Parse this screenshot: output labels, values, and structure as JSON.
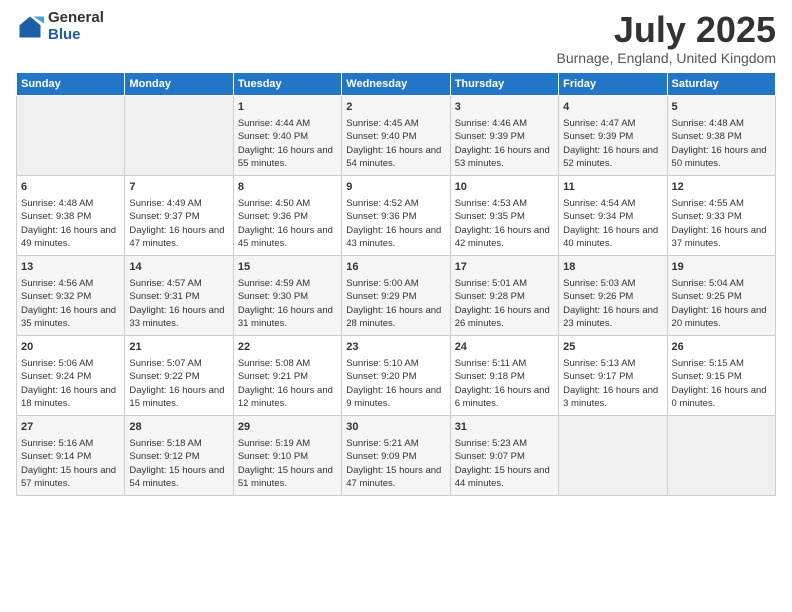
{
  "logo": {
    "general": "General",
    "blue": "Blue"
  },
  "title": "July 2025",
  "subtitle": "Burnage, England, United Kingdom",
  "days_of_week": [
    "Sunday",
    "Monday",
    "Tuesday",
    "Wednesday",
    "Thursday",
    "Friday",
    "Saturday"
  ],
  "weeks": [
    [
      {
        "day": "",
        "sunrise": "",
        "sunset": "",
        "daylight": ""
      },
      {
        "day": "",
        "sunrise": "",
        "sunset": "",
        "daylight": ""
      },
      {
        "day": "1",
        "sunrise": "Sunrise: 4:44 AM",
        "sunset": "Sunset: 9:40 PM",
        "daylight": "Daylight: 16 hours and 55 minutes."
      },
      {
        "day": "2",
        "sunrise": "Sunrise: 4:45 AM",
        "sunset": "Sunset: 9:40 PM",
        "daylight": "Daylight: 16 hours and 54 minutes."
      },
      {
        "day": "3",
        "sunrise": "Sunrise: 4:46 AM",
        "sunset": "Sunset: 9:39 PM",
        "daylight": "Daylight: 16 hours and 53 minutes."
      },
      {
        "day": "4",
        "sunrise": "Sunrise: 4:47 AM",
        "sunset": "Sunset: 9:39 PM",
        "daylight": "Daylight: 16 hours and 52 minutes."
      },
      {
        "day": "5",
        "sunrise": "Sunrise: 4:48 AM",
        "sunset": "Sunset: 9:38 PM",
        "daylight": "Daylight: 16 hours and 50 minutes."
      }
    ],
    [
      {
        "day": "6",
        "sunrise": "Sunrise: 4:48 AM",
        "sunset": "Sunset: 9:38 PM",
        "daylight": "Daylight: 16 hours and 49 minutes."
      },
      {
        "day": "7",
        "sunrise": "Sunrise: 4:49 AM",
        "sunset": "Sunset: 9:37 PM",
        "daylight": "Daylight: 16 hours and 47 minutes."
      },
      {
        "day": "8",
        "sunrise": "Sunrise: 4:50 AM",
        "sunset": "Sunset: 9:36 PM",
        "daylight": "Daylight: 16 hours and 45 minutes."
      },
      {
        "day": "9",
        "sunrise": "Sunrise: 4:52 AM",
        "sunset": "Sunset: 9:36 PM",
        "daylight": "Daylight: 16 hours and 43 minutes."
      },
      {
        "day": "10",
        "sunrise": "Sunrise: 4:53 AM",
        "sunset": "Sunset: 9:35 PM",
        "daylight": "Daylight: 16 hours and 42 minutes."
      },
      {
        "day": "11",
        "sunrise": "Sunrise: 4:54 AM",
        "sunset": "Sunset: 9:34 PM",
        "daylight": "Daylight: 16 hours and 40 minutes."
      },
      {
        "day": "12",
        "sunrise": "Sunrise: 4:55 AM",
        "sunset": "Sunset: 9:33 PM",
        "daylight": "Daylight: 16 hours and 37 minutes."
      }
    ],
    [
      {
        "day": "13",
        "sunrise": "Sunrise: 4:56 AM",
        "sunset": "Sunset: 9:32 PM",
        "daylight": "Daylight: 16 hours and 35 minutes."
      },
      {
        "day": "14",
        "sunrise": "Sunrise: 4:57 AM",
        "sunset": "Sunset: 9:31 PM",
        "daylight": "Daylight: 16 hours and 33 minutes."
      },
      {
        "day": "15",
        "sunrise": "Sunrise: 4:59 AM",
        "sunset": "Sunset: 9:30 PM",
        "daylight": "Daylight: 16 hours and 31 minutes."
      },
      {
        "day": "16",
        "sunrise": "Sunrise: 5:00 AM",
        "sunset": "Sunset: 9:29 PM",
        "daylight": "Daylight: 16 hours and 28 minutes."
      },
      {
        "day": "17",
        "sunrise": "Sunrise: 5:01 AM",
        "sunset": "Sunset: 9:28 PM",
        "daylight": "Daylight: 16 hours and 26 minutes."
      },
      {
        "day": "18",
        "sunrise": "Sunrise: 5:03 AM",
        "sunset": "Sunset: 9:26 PM",
        "daylight": "Daylight: 16 hours and 23 minutes."
      },
      {
        "day": "19",
        "sunrise": "Sunrise: 5:04 AM",
        "sunset": "Sunset: 9:25 PM",
        "daylight": "Daylight: 16 hours and 20 minutes."
      }
    ],
    [
      {
        "day": "20",
        "sunrise": "Sunrise: 5:06 AM",
        "sunset": "Sunset: 9:24 PM",
        "daylight": "Daylight: 16 hours and 18 minutes."
      },
      {
        "day": "21",
        "sunrise": "Sunrise: 5:07 AM",
        "sunset": "Sunset: 9:22 PM",
        "daylight": "Daylight: 16 hours and 15 minutes."
      },
      {
        "day": "22",
        "sunrise": "Sunrise: 5:08 AM",
        "sunset": "Sunset: 9:21 PM",
        "daylight": "Daylight: 16 hours and 12 minutes."
      },
      {
        "day": "23",
        "sunrise": "Sunrise: 5:10 AM",
        "sunset": "Sunset: 9:20 PM",
        "daylight": "Daylight: 16 hours and 9 minutes."
      },
      {
        "day": "24",
        "sunrise": "Sunrise: 5:11 AM",
        "sunset": "Sunset: 9:18 PM",
        "daylight": "Daylight: 16 hours and 6 minutes."
      },
      {
        "day": "25",
        "sunrise": "Sunrise: 5:13 AM",
        "sunset": "Sunset: 9:17 PM",
        "daylight": "Daylight: 16 hours and 3 minutes."
      },
      {
        "day": "26",
        "sunrise": "Sunrise: 5:15 AM",
        "sunset": "Sunset: 9:15 PM",
        "daylight": "Daylight: 16 hours and 0 minutes."
      }
    ],
    [
      {
        "day": "27",
        "sunrise": "Sunrise: 5:16 AM",
        "sunset": "Sunset: 9:14 PM",
        "daylight": "Daylight: 15 hours and 57 minutes."
      },
      {
        "day": "28",
        "sunrise": "Sunrise: 5:18 AM",
        "sunset": "Sunset: 9:12 PM",
        "daylight": "Daylight: 15 hours and 54 minutes."
      },
      {
        "day": "29",
        "sunrise": "Sunrise: 5:19 AM",
        "sunset": "Sunset: 9:10 PM",
        "daylight": "Daylight: 15 hours and 51 minutes."
      },
      {
        "day": "30",
        "sunrise": "Sunrise: 5:21 AM",
        "sunset": "Sunset: 9:09 PM",
        "daylight": "Daylight: 15 hours and 47 minutes."
      },
      {
        "day": "31",
        "sunrise": "Sunrise: 5:23 AM",
        "sunset": "Sunset: 9:07 PM",
        "daylight": "Daylight: 15 hours and 44 minutes."
      },
      {
        "day": "",
        "sunrise": "",
        "sunset": "",
        "daylight": ""
      },
      {
        "day": "",
        "sunrise": "",
        "sunset": "",
        "daylight": ""
      }
    ]
  ]
}
